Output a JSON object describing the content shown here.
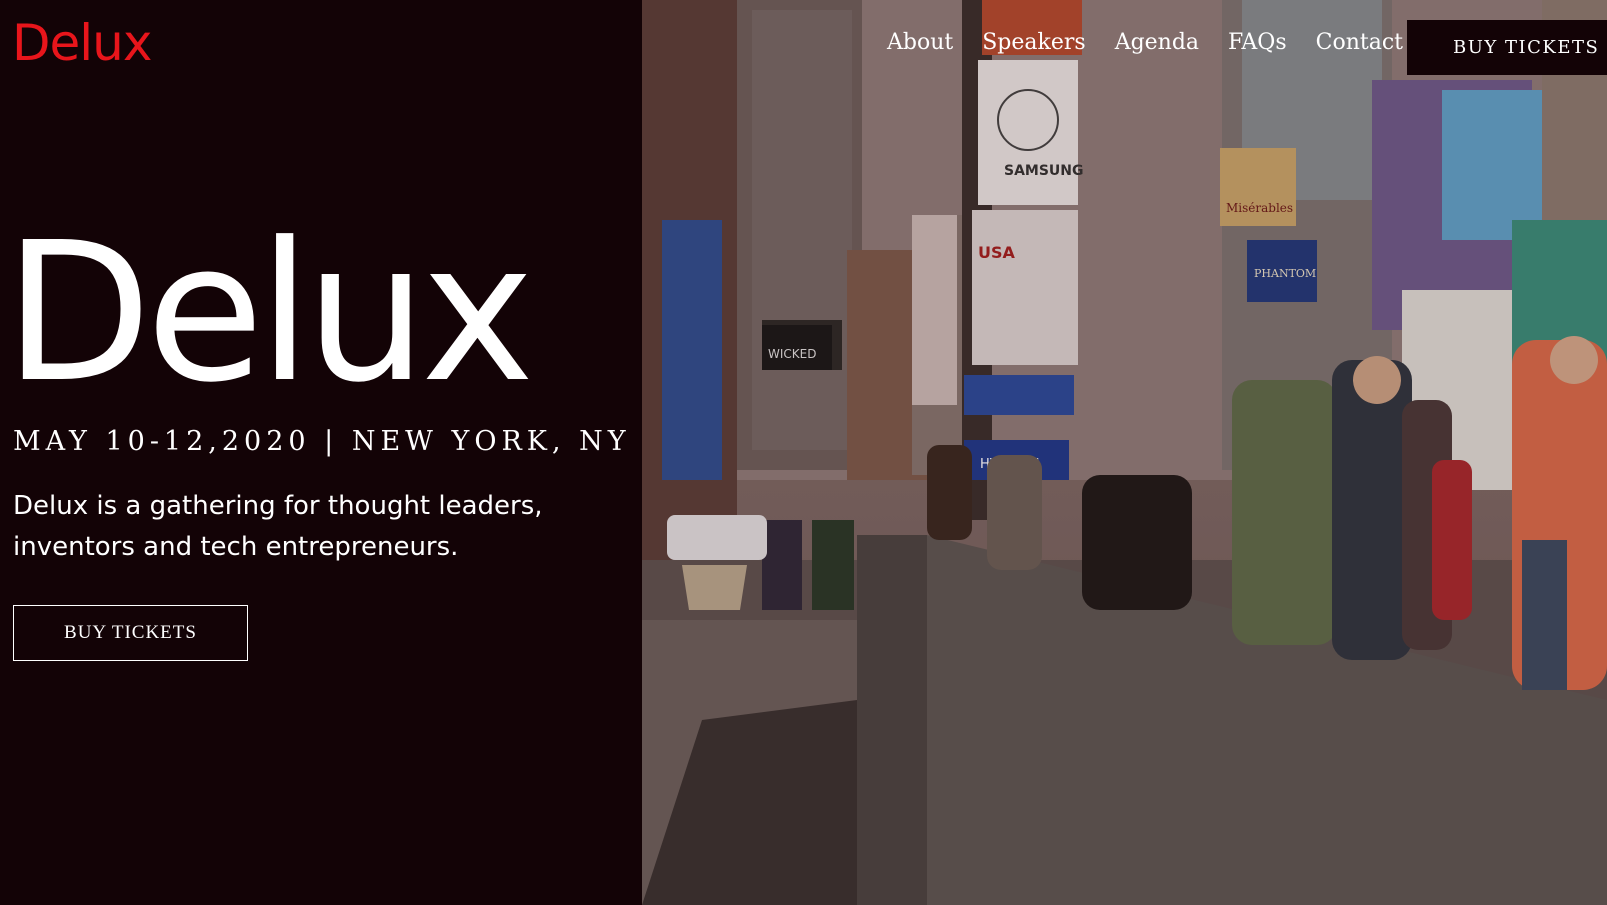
{
  "brand": {
    "logo": "Delux"
  },
  "nav": {
    "items": [
      "About",
      "Speakers",
      "Agenda",
      "FAQs",
      "Contact"
    ],
    "cta_label": "BUY TICKETS"
  },
  "hero": {
    "title": "Delux",
    "meta": "MAY 10-12,2020 | NEW YORK, NY",
    "description": "Delux is a gathering for thought leaders, inventors and tech entrepreneurs.",
    "cta_label": "BUY TICKETS"
  },
  "colors": {
    "accent": "#e8151b",
    "background": "#130306",
    "text": "#ffffff"
  },
  "photo": {
    "signs": [
      "SAMSUNG",
      "USA",
      "WICKED",
      "PHANTOM",
      "Misérables",
      "HYUNDAI"
    ]
  }
}
